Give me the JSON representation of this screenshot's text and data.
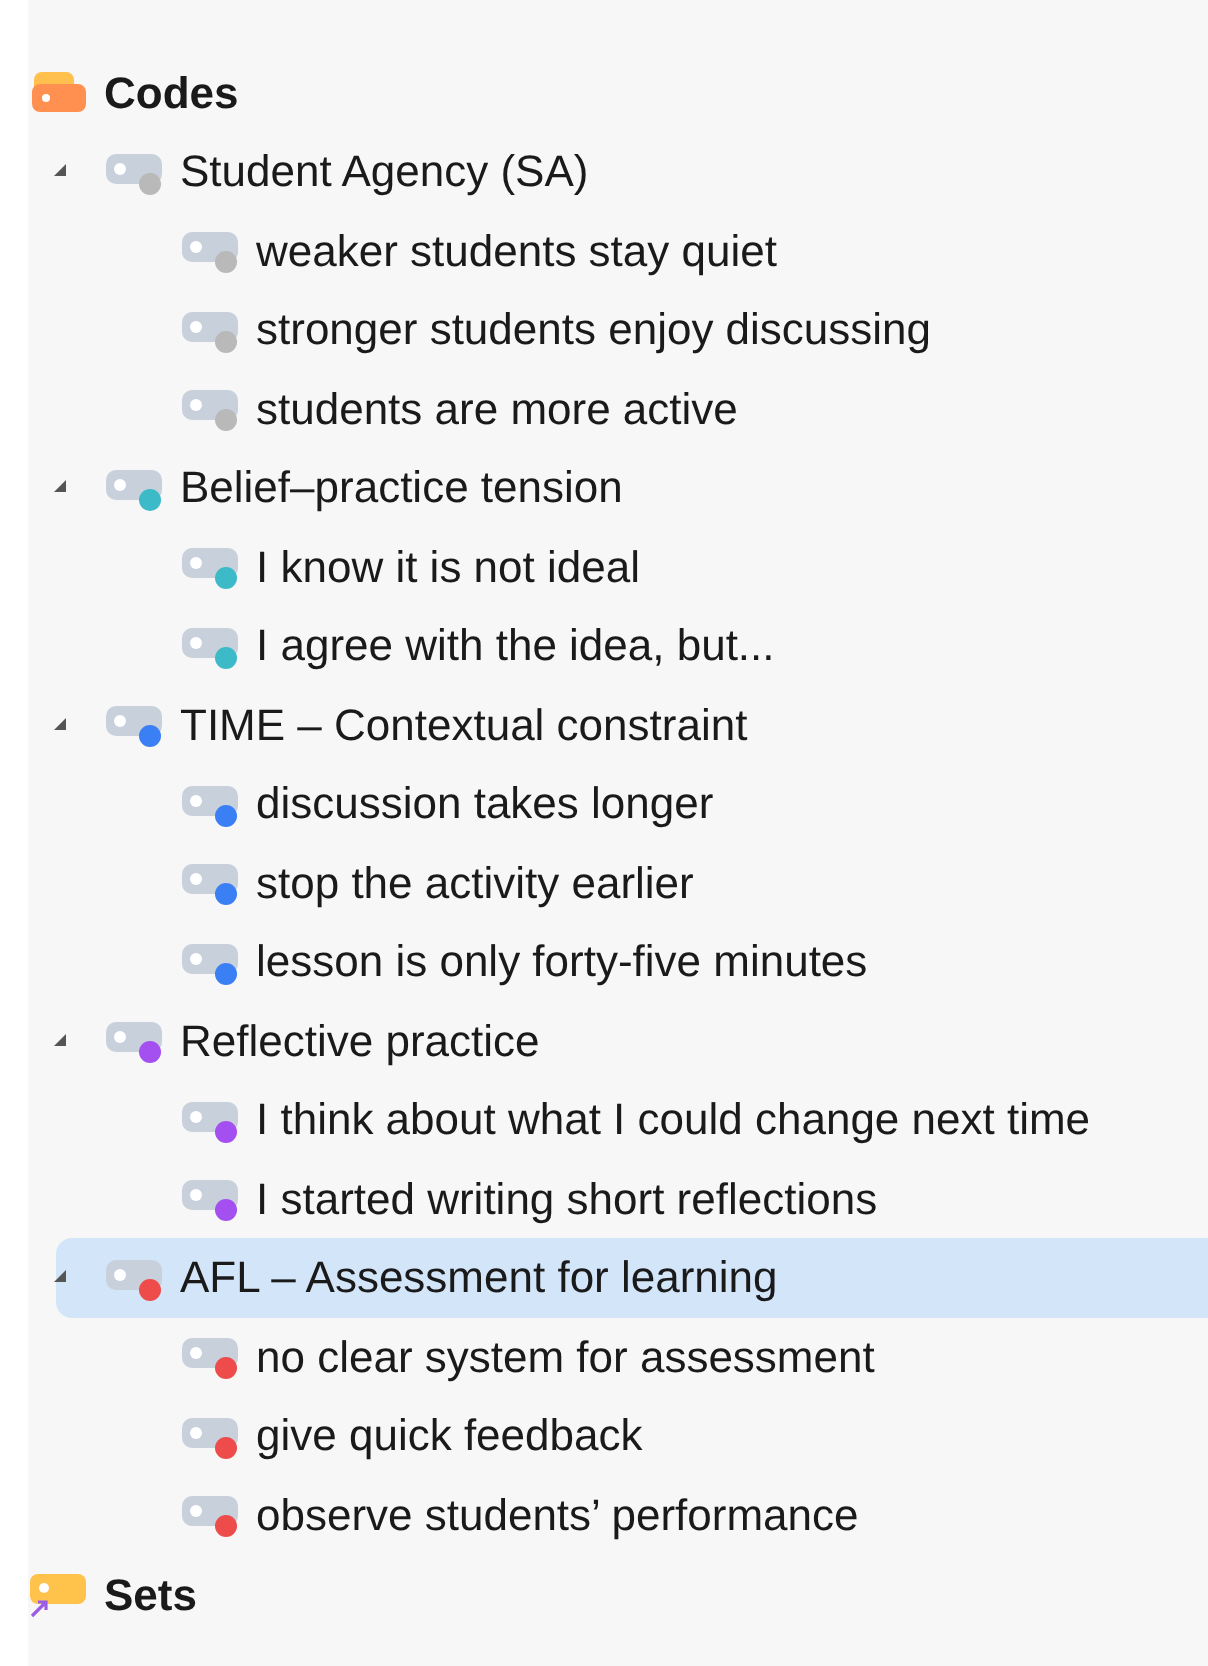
{
  "codes": {
    "title": "Codes",
    "children": [
      {
        "label": "Student Agency (SA)",
        "color": "#b9b9b9",
        "selected": false,
        "expanded": true,
        "children": [
          {
            "label": "weaker students stay quiet",
            "color": "#b9b9b9",
            "selected": false
          },
          {
            "label": "stronger students enjoy discussing",
            "color": "#b9b9b9",
            "selected": false
          },
          {
            "label": "students are more active",
            "color": "#b9b9b9",
            "selected": false
          }
        ]
      },
      {
        "label": "Belief–practice tension",
        "color": "#3cbac8",
        "selected": false,
        "expanded": true,
        "children": [
          {
            "label": "I know it is not ideal",
            "color": "#3cbac8",
            "selected": false
          },
          {
            "label": "I agree with the idea, but...",
            "color": "#3cbac8",
            "selected": false
          }
        ]
      },
      {
        "label": "TIME – Contextual constraint",
        "color": "#3b7ff5",
        "selected": false,
        "expanded": true,
        "children": [
          {
            "label": "discussion takes longer",
            "color": "#3b7ff5",
            "selected": false
          },
          {
            "label": "stop the activity earlier",
            "color": "#3b7ff5",
            "selected": false
          },
          {
            "label": "lesson is only forty-five minutes",
            "color": "#3b7ff5",
            "selected": false
          }
        ]
      },
      {
        "label": "Reflective practice",
        "color": "#a44ff0",
        "selected": false,
        "expanded": true,
        "children": [
          {
            "label": "I think about what I could change next time",
            "color": "#a44ff0",
            "selected": false
          },
          {
            "label": "I started writing short reflections",
            "color": "#a44ff0",
            "selected": false
          }
        ]
      },
      {
        "label": "AFL – Assessment for learning",
        "color": "#ee4b4b",
        "selected": true,
        "expanded": true,
        "children": [
          {
            "label": "no clear system for assessment",
            "color": "#ee4b4b",
            "selected": false
          },
          {
            "label": "give quick feedback",
            "color": "#ee4b4b",
            "selected": false
          },
          {
            "label": "observe students’ performance",
            "color": "#ee4b4b",
            "selected": false
          }
        ]
      }
    ]
  },
  "sets": {
    "title": "Sets"
  }
}
